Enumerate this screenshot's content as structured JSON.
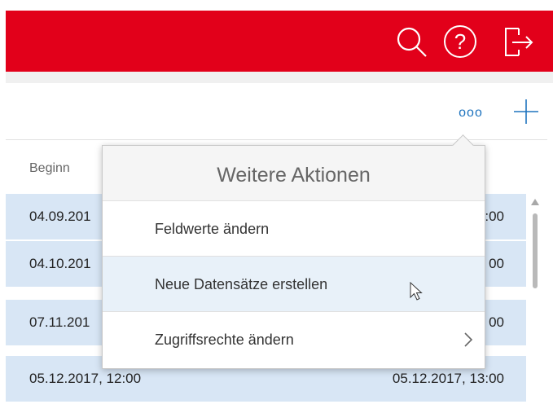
{
  "header": {
    "icons": [
      "search-icon",
      "help-icon",
      "logout-icon"
    ],
    "help_symbol": "?"
  },
  "toolbar": {
    "more_label": "ooo",
    "icons": [
      "more-icon",
      "add-icon"
    ]
  },
  "table": {
    "column_header": "Beginn",
    "rows": [
      {
        "begin": "04.09.201",
        "end": ":00"
      },
      {
        "begin": "04.10.201",
        "end": "00"
      },
      {
        "begin": "07.11.201",
        "end": "00"
      },
      {
        "begin": "05.12.2017, 12:00",
        "end": "05.12.2017, 13:00"
      }
    ]
  },
  "popover": {
    "title": "Weitere Aktionen",
    "items": [
      {
        "label": "Feldwerte ändern"
      },
      {
        "label": "Neue Datensätze erstellen"
      },
      {
        "label": "Zugriffsrechte ändern"
      }
    ]
  },
  "colors": {
    "brand": "#e2001a",
    "row_bg": "#d8e6f5",
    "accent": "#1e73be",
    "hover_bg": "#e8f1f9"
  }
}
